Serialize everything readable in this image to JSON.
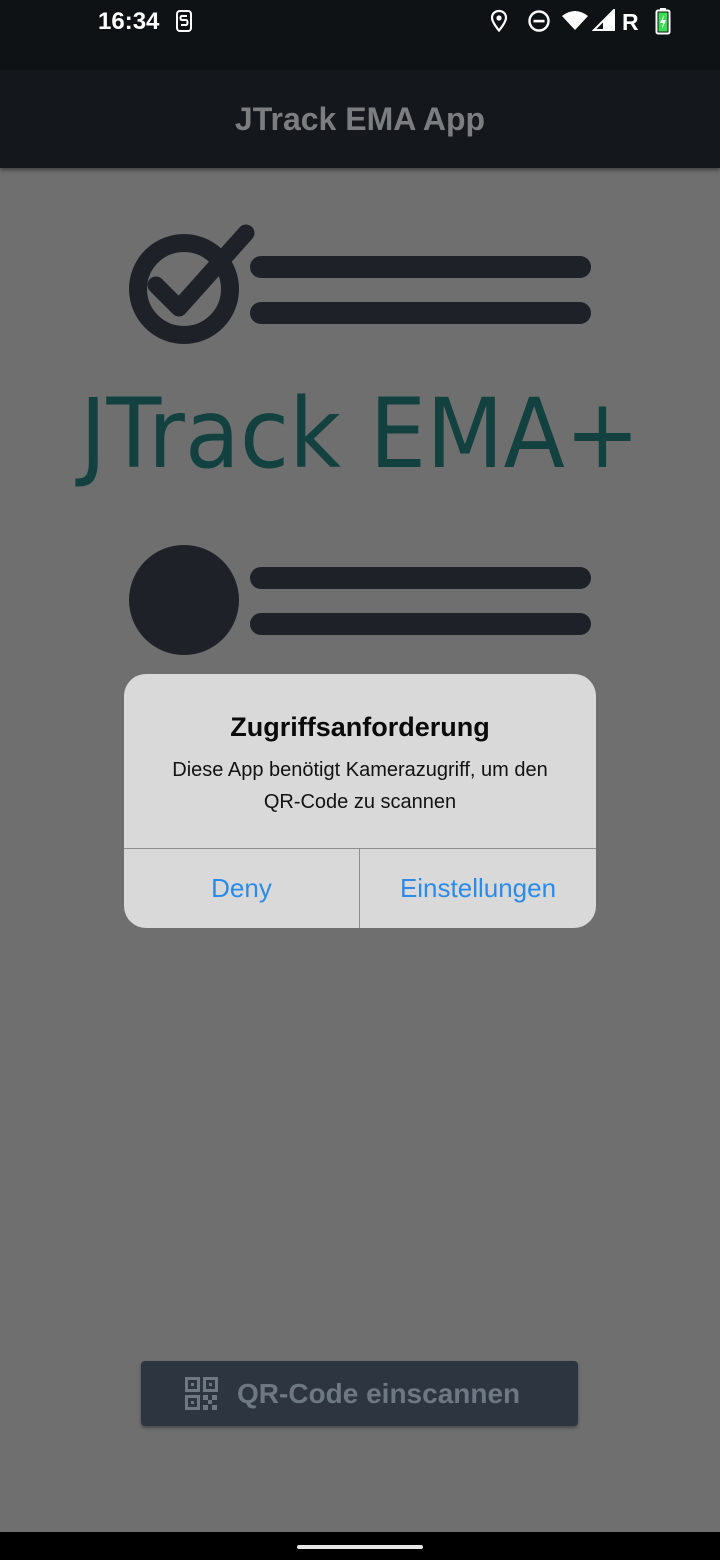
{
  "status_bar": {
    "time": "16:34",
    "roaming": "R",
    "icons": [
      "notification-s-icon",
      "location-icon",
      "do-not-disturb-icon",
      "wifi-icon",
      "signal-icon",
      "battery-charging-icon"
    ]
  },
  "app_bar": {
    "title": "JTrack EMA App"
  },
  "logo": {
    "wordmark": "JTrack EMA+",
    "color": "#12413f",
    "shape_color": "#1e2127"
  },
  "dialog": {
    "title": "Zugriffsanforderung",
    "message": "Diese App benötigt Kamerazugriff, um den QR-Code zu scannen",
    "deny_label": "Deny",
    "settings_label": "Einstellungen",
    "button_color": "#2a8ce8"
  },
  "scan_button": {
    "label": "QR-Code einscannen",
    "icon": "qr-code-icon"
  },
  "nav_bar": {
    "icon": "home-pill"
  }
}
